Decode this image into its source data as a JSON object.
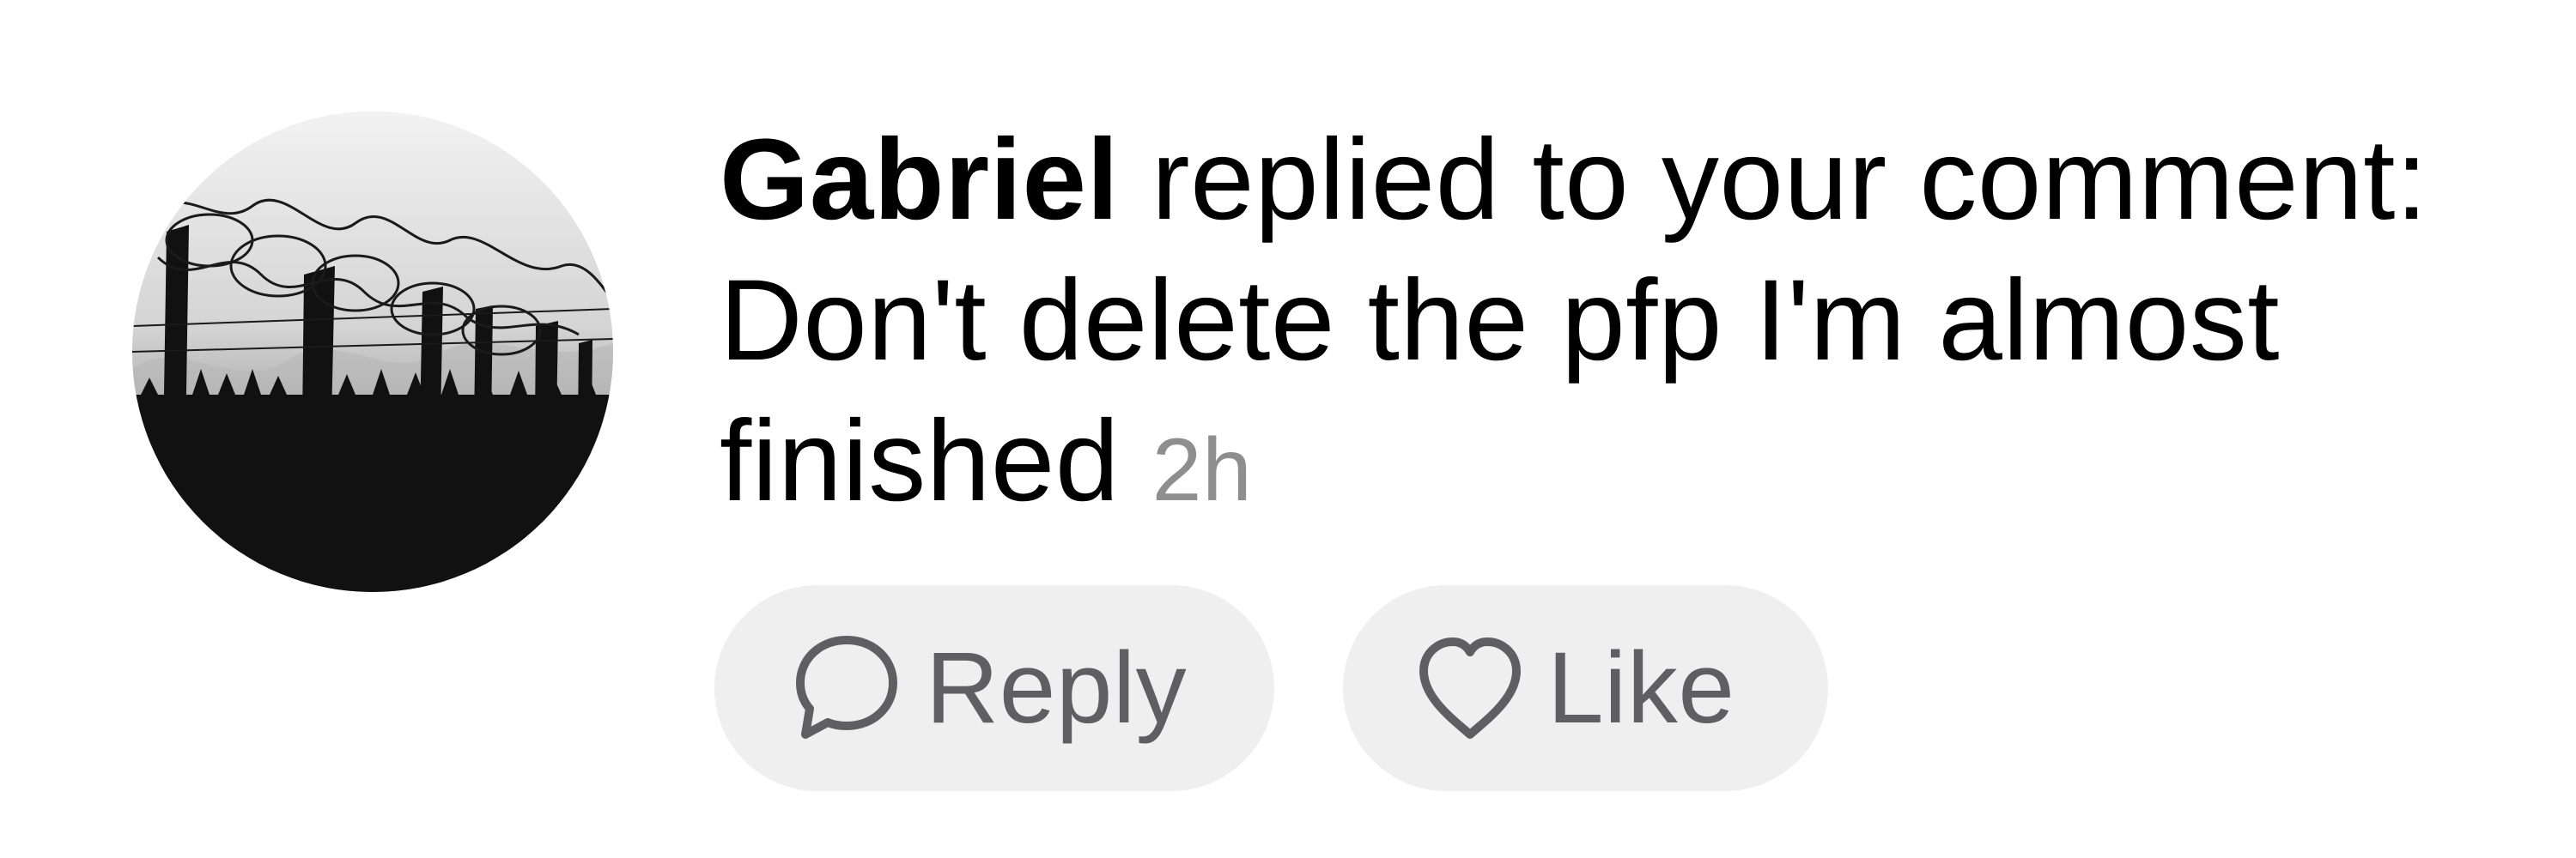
{
  "notification": {
    "username": "Gabriel",
    "action_text": " replied to your comment: Don't delete the pfp I'm almost finished",
    "timestamp": "2h",
    "avatar_icon": "barbed-wire-fence-photo"
  },
  "actions": {
    "reply": {
      "label": "Reply",
      "icon": "speech-bubble-icon"
    },
    "like": {
      "label": "Like",
      "icon": "heart-icon"
    }
  },
  "colors": {
    "text": "#000000",
    "timestamp": "#8e8e8e",
    "pill_background": "#efeff0",
    "pill_text": "#5f5f62"
  }
}
